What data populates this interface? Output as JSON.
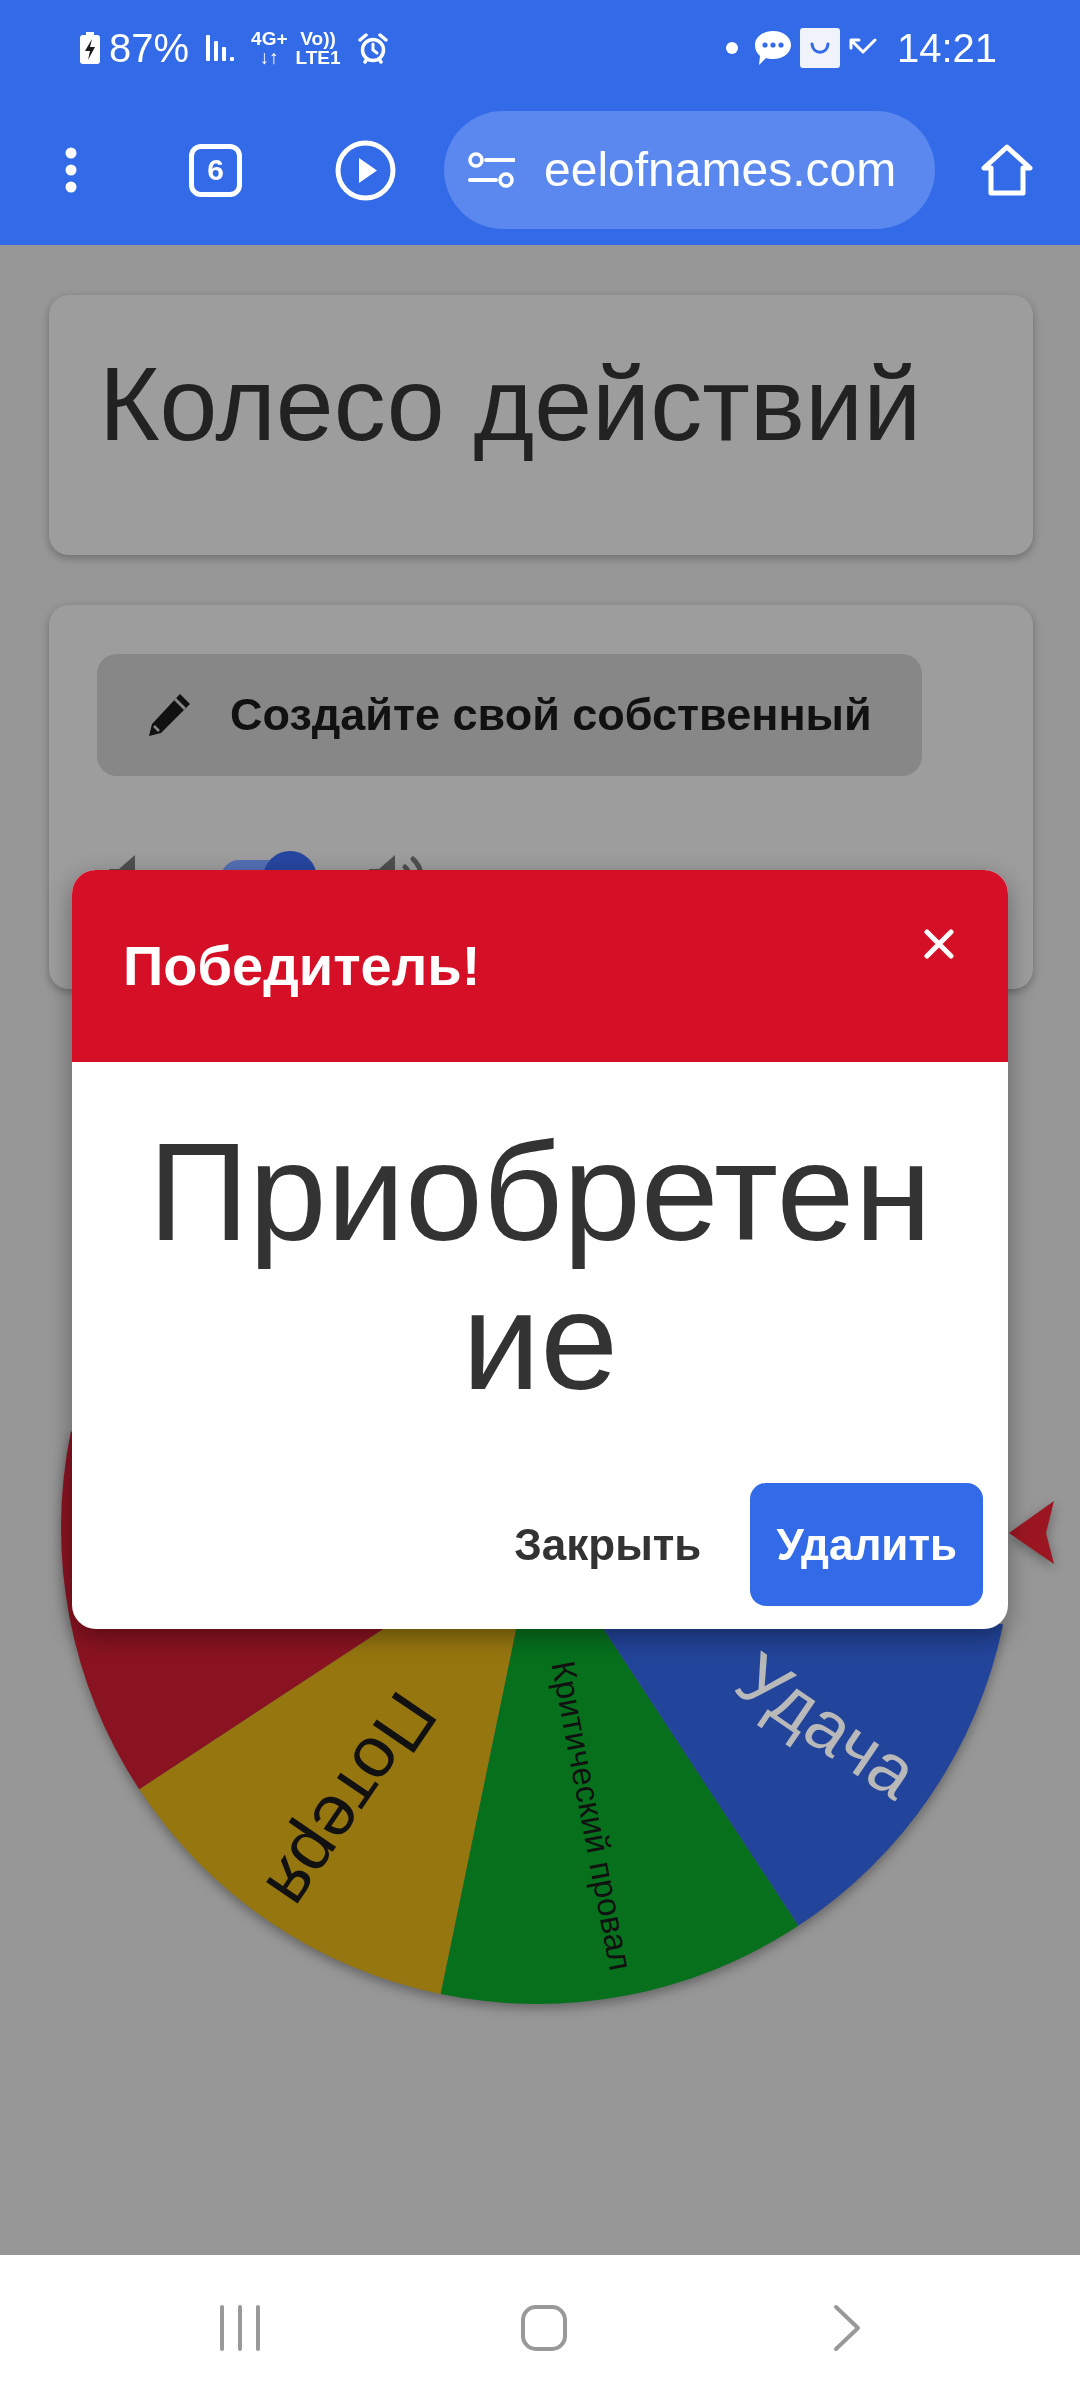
{
  "status_bar": {
    "battery": "87%",
    "network_type": "4G+",
    "data_arrows": "↓↑",
    "volte": "Vo))",
    "volte_line": "LTE1",
    "time": "14:21"
  },
  "browser_bar": {
    "tab_count": "6",
    "url": "eelofnames.com"
  },
  "page": {
    "title": "Колесо действий",
    "create_button": "Создайте свой собственный",
    "sound_toggle": {
      "on": true
    }
  },
  "wheel": {
    "segments": [
      {
        "label": "Удача",
        "color": "#22449a"
      },
      {
        "label": "Критический провал",
        "color": "#06701d"
      },
      {
        "label": "Потеря",
        "color": "#96760f"
      },
      {
        "color": "#8a1321"
      }
    ]
  },
  "dialog": {
    "title": "Победитель!",
    "winner": "Приобретение",
    "buttons": [
      {
        "label": "Закрыть",
        "kind": "text"
      },
      {
        "label": "Удалить",
        "kind": "primary"
      }
    ]
  }
}
